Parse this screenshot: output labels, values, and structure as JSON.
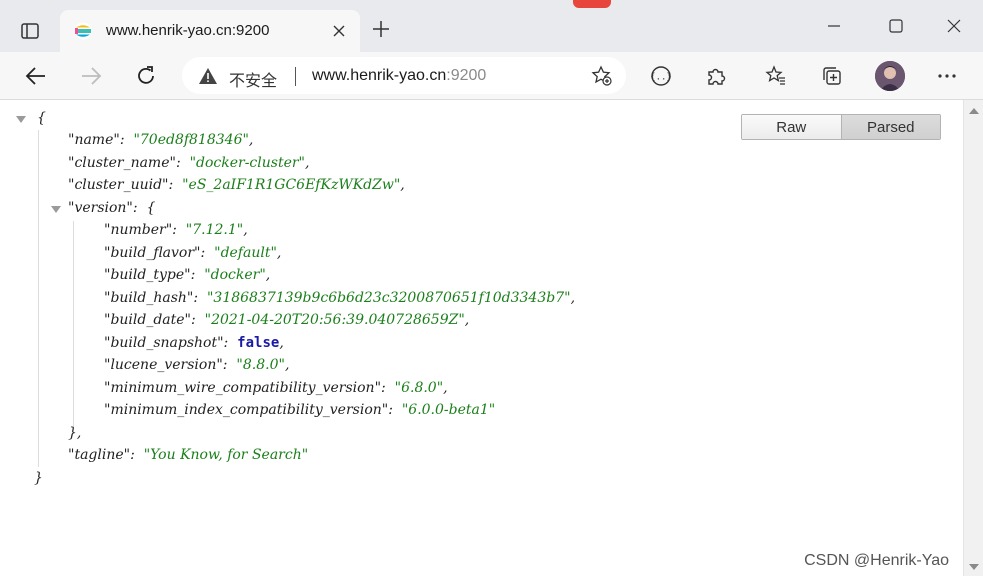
{
  "browser": {
    "tab": {
      "title": "www.henrik-yao.cn:9200"
    },
    "address_bar": {
      "security_label": "不安全",
      "url_host": "www.henrik-yao.cn",
      "url_port": ":9200"
    }
  },
  "viewer": {
    "raw_label": "Raw",
    "parsed_label": "Parsed",
    "selected": "Parsed"
  },
  "json_lines": [
    {
      "k": "\"name\"",
      "v": "\"70ed8f818346\"",
      "t": "str",
      "end": ","
    },
    {
      "k": "\"cluster_name\"",
      "v": "\"docker-cluster\"",
      "t": "str",
      "end": ","
    },
    {
      "k": "\"cluster_uuid\"",
      "v": "\"eS_2aIF1R1GC6EfKzWKdZw\"",
      "t": "str",
      "end": ","
    },
    {
      "k": "\"version\"",
      "v": "{",
      "t": "punct",
      "end": ""
    },
    {
      "k": "\"number\"",
      "v": "\"7.12.1\"",
      "t": "str",
      "end": ","
    },
    {
      "k": "\"build_flavor\"",
      "v": "\"default\"",
      "t": "str",
      "end": ","
    },
    {
      "k": "\"build_type\"",
      "v": "\"docker\"",
      "t": "str",
      "end": ","
    },
    {
      "k": "\"build_hash\"",
      "v": "\"3186837139b9c6b6d23c3200870651f10d3343b7\"",
      "t": "str",
      "end": ","
    },
    {
      "k": "\"build_date\"",
      "v": "\"2021-04-20T20:56:39.040728659Z\"",
      "t": "str",
      "end": ","
    },
    {
      "k": "\"build_snapshot\"",
      "v": "false",
      "t": "bool",
      "end": ","
    },
    {
      "k": "\"lucene_version\"",
      "v": "\"8.8.0\"",
      "t": "str",
      "end": ","
    },
    {
      "k": "\"minimum_wire_compatibility_version\"",
      "v": "\"6.8.0\"",
      "t": "str",
      "end": ","
    },
    {
      "k": "\"minimum_index_compatibility_version\"",
      "v": "\"6.0.0-beta1\"",
      "t": "str",
      "end": ""
    },
    {
      "k": "\"tagline\"",
      "v": "\"You Know, for Search\"",
      "t": "str",
      "end": ""
    }
  ],
  "braces": {
    "open": "{",
    "close": "}",
    "inner_close": "},"
  },
  "watermark": "CSDN @Henrik-Yao",
  "colors": {
    "string": "#1a7f1a",
    "boolean": "#1a1aa6",
    "tab_strip": "#e9eaed"
  }
}
